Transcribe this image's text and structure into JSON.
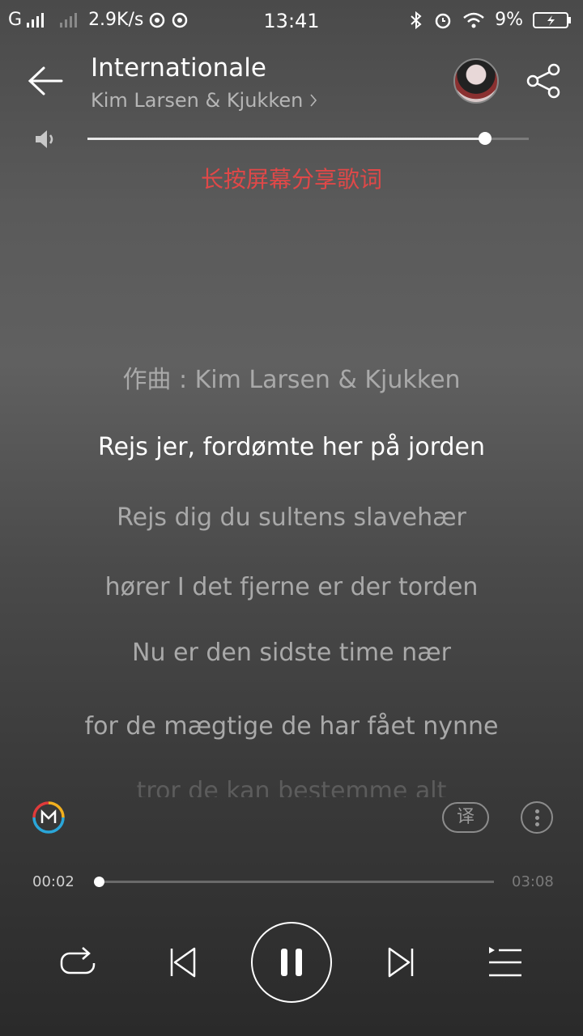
{
  "status_bar": {
    "carrier": "G",
    "net_speed": "2.9K/s",
    "time": "13:41",
    "battery": "9%"
  },
  "header": {
    "title": "Internationale",
    "artist": "Kim Larsen & Kjukken",
    "back_icon": "back-arrow-icon",
    "share_icon": "share-icon"
  },
  "volume": {
    "level": 0.9
  },
  "share_hint": "长按屏幕分享歌词",
  "lyrics": [
    {
      "text": "作曲 : Kim Larsen & Kjukken",
      "state": "past"
    },
    {
      "text": "Rejs jer, fordømte her på jorden",
      "state": "current"
    },
    {
      "text": "Rejs dig du sultens slavehær",
      "state": "upcoming"
    },
    {
      "text": "hører I det fjerne er der torden",
      "state": "upcoming"
    },
    {
      "text": "Nu er den sidste time nær",
      "state": "upcoming"
    },
    {
      "text": "for de mægtige de har fået nynne",
      "state": "upcoming"
    },
    {
      "text": "tror de kan bestemme alt",
      "state": "fading"
    }
  ],
  "tools": {
    "translate_label": "译"
  },
  "playback": {
    "current_time": "00:02",
    "total_time": "03:08",
    "progress": 0.011
  },
  "colors": {
    "accent": "#e04848",
    "current_lyric": "#ffffff",
    "other_lyric": "#a9a9a9"
  }
}
